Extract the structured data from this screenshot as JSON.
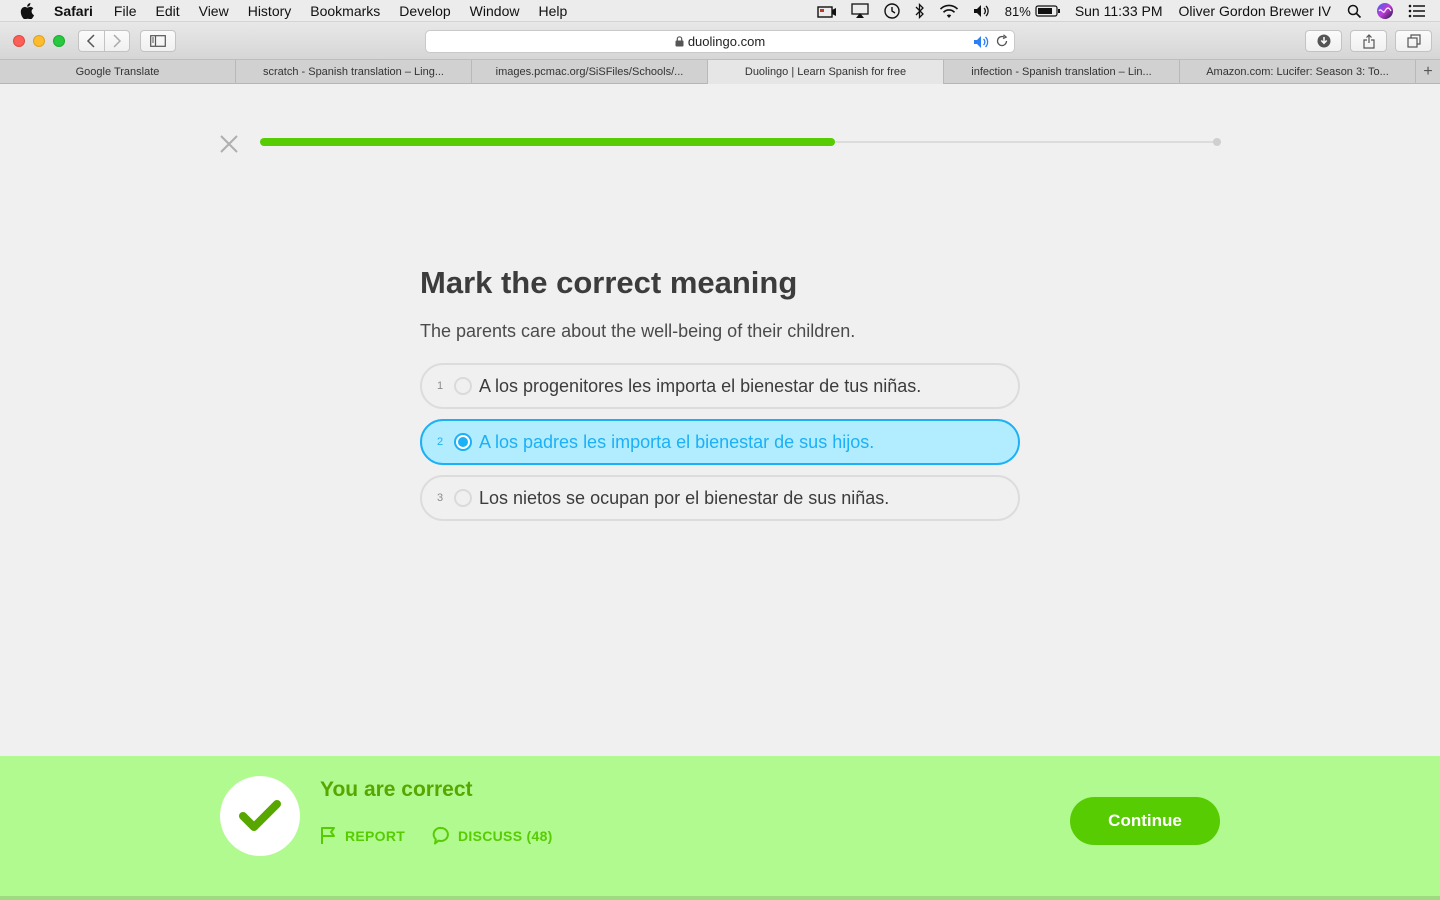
{
  "menubar": {
    "app_name": "Safari",
    "items": [
      "File",
      "Edit",
      "View",
      "History",
      "Bookmarks",
      "Develop",
      "Window",
      "Help"
    ],
    "battery_percent": "81%",
    "clock": "Sun 11:33 PM",
    "user": "Oliver Gordon Brewer IV"
  },
  "browser": {
    "url": "duolingo.com",
    "tabs": [
      {
        "title": "Google Translate",
        "active": false
      },
      {
        "title": "scratch - Spanish translation – Ling...",
        "active": false
      },
      {
        "title": "images.pcmac.org/SiSFiles/Schools/...",
        "active": false
      },
      {
        "title": "Duolingo | Learn Spanish for free",
        "active": true
      },
      {
        "title": "infection - Spanish translation – Lin...",
        "active": false
      },
      {
        "title": "Amazon.com: Lucifer: Season 3: To...",
        "active": false
      }
    ],
    "new_tab_label": "+"
  },
  "lesson": {
    "progress": 0.6,
    "title": "Mark the correct meaning",
    "sentence": "The parents care about the well-being of their children.",
    "choices": [
      {
        "number": "1",
        "text": "A los progenitores les importa el bienestar de tus niñas.",
        "selected": false
      },
      {
        "number": "2",
        "text": "A los padres les importa el bienestar de sus hijos.",
        "selected": true
      },
      {
        "number": "3",
        "text": "Los nietos se ocupan por el bienestar de sus niñas.",
        "selected": false
      }
    ]
  },
  "feedback": {
    "title": "You are correct",
    "report_label": "REPORT",
    "discuss_label": "DISCUSS (48)",
    "continue_label": "Continue"
  },
  "colors": {
    "accent_green": "#58cc02",
    "feedback_bg": "#b0fa8f",
    "selected_blue": "#1cb0f6",
    "selected_bg": "#b1ecff"
  }
}
